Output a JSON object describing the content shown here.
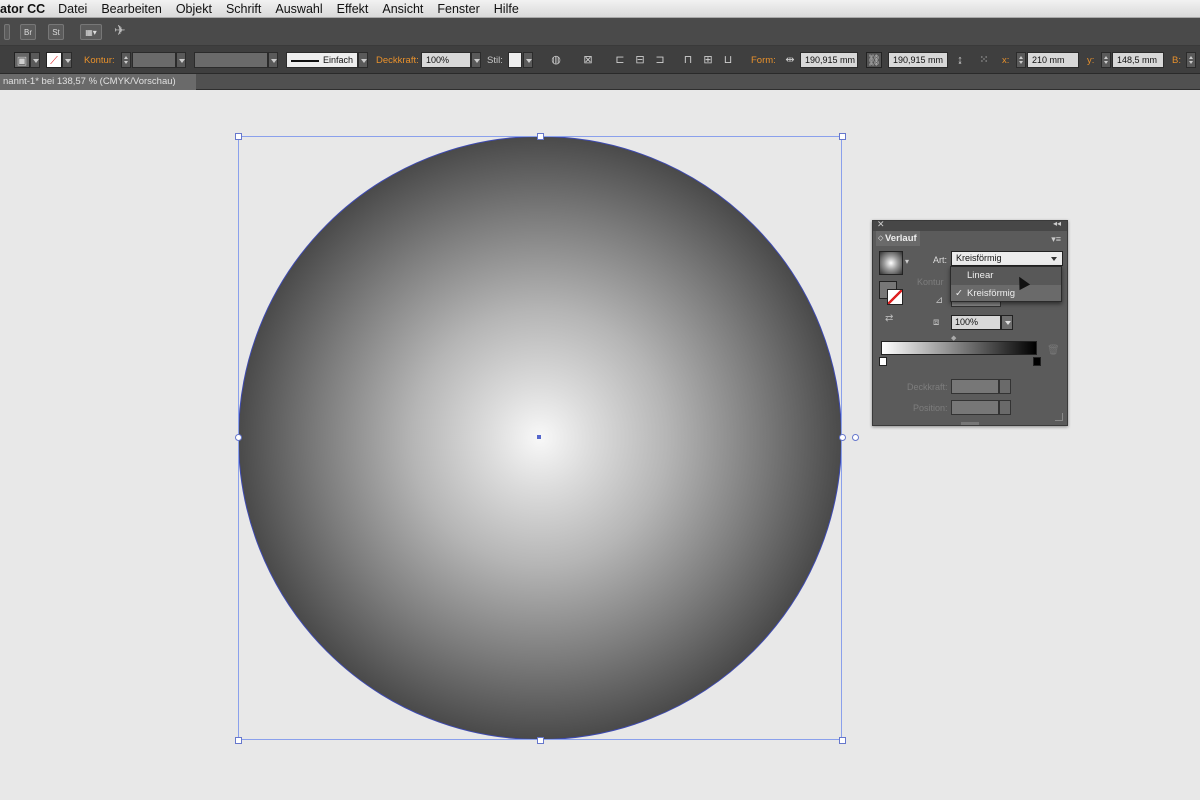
{
  "menubar": {
    "app_name": "ator CC",
    "items": [
      "Datei",
      "Bearbeiten",
      "Objekt",
      "Schrift",
      "Auswahl",
      "Effekt",
      "Ansicht",
      "Fenster",
      "Hilfe"
    ]
  },
  "appbar": {
    "br_label": "Br",
    "st_label": "St"
  },
  "controlbar": {
    "kontur_label": "Kontur:",
    "stroke_profile": "Einfach",
    "deckkraft_label": "Deckkraft:",
    "deckkraft_value": "100%",
    "stil_label": "Stil:",
    "form_label": "Form:",
    "width_value": "190,915 mm",
    "height_value": "190,915 mm",
    "x_label": "x:",
    "x_value": "210 mm",
    "y_label": "y:",
    "y_value": "148,5 mm",
    "b_label": "B:"
  },
  "document": {
    "tab_title": "nannt-1* bei 138,57 % (CMYK/Vorschau)"
  },
  "gradient_panel": {
    "title": "Verlauf",
    "art_label": "Art:",
    "art_selected": "Kreisförmig",
    "kontur_label": "Kontur",
    "aspect_value": "100%",
    "deckkraft_label": "Deckkraft:",
    "position_label": "Position:",
    "dropdown_options": [
      "Linear",
      "Kreisförmig"
    ],
    "check_mark": "✓"
  },
  "colors": {
    "accent_orange": "#e8912c",
    "selection_blue": "#8aa0ec",
    "panel_bg": "#5b5b5b",
    "canvas_bg": "#e8e8e8"
  }
}
